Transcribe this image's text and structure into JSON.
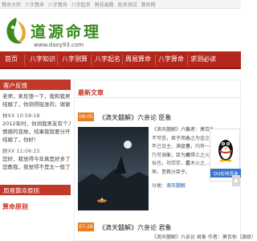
{
  "topbar": {
    "crumbs": [
      "算命大师",
      "八字算命",
      "八字算命",
      "八字起名",
      "梅花易数",
      "姓名测试",
      "算命网"
    ]
  },
  "header": {
    "title": "道源命理",
    "url": "www.daoy93.com"
  },
  "nav": [
    "首页",
    "八字知识",
    "八字测算",
    "八字起名",
    "周易算命",
    "八字算命",
    "求测必读"
  ],
  "sidebar": {
    "title": "客户反馈",
    "comments": [
      {
        "lines": [
          "老师，来反馈一下，我和我男友",
          "结婚了，你测得挺准的，谢谢您"
        ]
      },
      {
        "meta": "林XX 10:58:18",
        "lines": [
          "2012年时，你测我男友有个人",
          "情感的变故，结果我就要分开",
          "结婚了，你好！"
        ]
      },
      {
        "meta": "顾XX 11:06:15",
        "lines": [
          "您好，我觉得今年真是好多了，",
          "您教我，我觉得不是太一般了"
        ]
      }
    ],
    "section2_title": "周易算命原则",
    "section2_sub": "算命原则"
  },
  "main": {
    "section_title": "最新文章",
    "posts": [
      {
        "date": "08-05",
        "title": "《滴天髓解》六亲论 臣象",
        "excerpt": [
          "《滴天髓解》六亲",
          "不可信，君子用心",
          "年己日主，满盘皆",
          "乃可调衡，臣为君",
          "似也，功劳存，这",
          "伸，贵教分臣乎。"
        ],
        "excerpt2": [
          "作者：萧百佑（源原）",
          "木之为金之辉，说话",
          "水，内有一二金气，",
          "用得土之火，以造大",
          "若木火之..."
        ],
        "category_label": "分类：",
        "category": "滴天髓解"
      },
      {
        "date": "07-28",
        "title": "《滴天髓解》六亲论 君象",
        "excerpt": [
          "《滴天髓解》六亲论 君象 作者：萧百佑（源原） 分会"
        ]
      }
    ]
  },
  "widget": {
    "online": "QQ在线咨询",
    "scroll_up": "▲"
  },
  "colors": {
    "nav": "#b4271c",
    "accent": "#c0392b",
    "logo_green": "#3a8a1e",
    "date_badge": "#e67e22",
    "qq_blue": "#3a76d0"
  }
}
